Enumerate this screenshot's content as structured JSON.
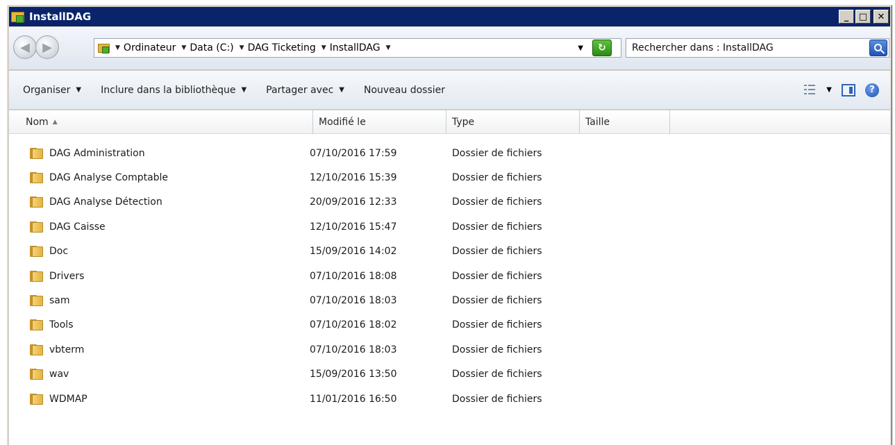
{
  "window": {
    "title": "InstallDAG"
  },
  "title_controls": {
    "minimize": "_",
    "maximize": "□",
    "close": "✕"
  },
  "nav": {
    "back": "◀",
    "forward": "▶"
  },
  "breadcrumb": [
    "Ordinateur",
    "Data (C:)",
    "DAG Ticketing",
    "InstallDAG"
  ],
  "search": {
    "placeholder": "Rechercher dans : InstallDAG"
  },
  "toolbar": {
    "organize": "Organiser",
    "include_library": "Inclure dans la bibliothèque",
    "share_with": "Partager avec",
    "new_folder": "Nouveau dossier"
  },
  "columns": {
    "name": "Nom",
    "modified": "Modifié le",
    "type": "Type",
    "size": "Taille"
  },
  "files": [
    {
      "name": "DAG Administration",
      "modified": "07/10/2016 17:59",
      "type": "Dossier de fichiers",
      "size": ""
    },
    {
      "name": "DAG Analyse Comptable",
      "modified": "12/10/2016 15:39",
      "type": "Dossier de fichiers",
      "size": ""
    },
    {
      "name": "DAG Analyse Détection",
      "modified": "20/09/2016 12:33",
      "type": "Dossier de fichiers",
      "size": ""
    },
    {
      "name": "DAG Caisse",
      "modified": "12/10/2016 15:47",
      "type": "Dossier de fichiers",
      "size": ""
    },
    {
      "name": "Doc",
      "modified": "15/09/2016 14:02",
      "type": "Dossier de fichiers",
      "size": ""
    },
    {
      "name": "Drivers",
      "modified": "07/10/2016 18:08",
      "type": "Dossier de fichiers",
      "size": ""
    },
    {
      "name": "sam",
      "modified": "07/10/2016 18:03",
      "type": "Dossier de fichiers",
      "size": ""
    },
    {
      "name": "Tools",
      "modified": "07/10/2016 18:02",
      "type": "Dossier de fichiers",
      "size": ""
    },
    {
      "name": "vbterm",
      "modified": "07/10/2016 18:03",
      "type": "Dossier de fichiers",
      "size": ""
    },
    {
      "name": "wav",
      "modified": "15/09/2016 13:50",
      "type": "Dossier de fichiers",
      "size": ""
    },
    {
      "name": "WDMAP",
      "modified": "11/01/2016 16:50",
      "type": "Dossier de fichiers",
      "size": ""
    }
  ],
  "icons": {
    "folder": "folder-icon",
    "search": "search-icon",
    "refresh": "refresh-icon",
    "view": "view-icon",
    "preview_pane": "preview-pane-icon",
    "help": "help-icon"
  }
}
